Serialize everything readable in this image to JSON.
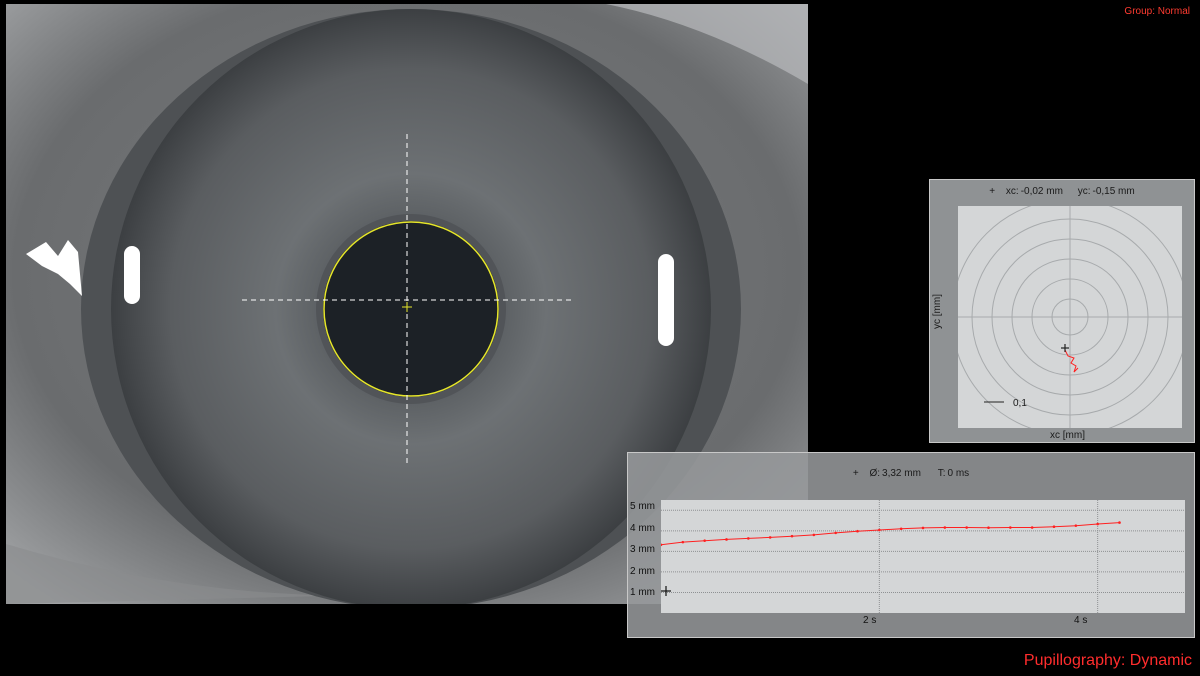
{
  "header": {
    "group_label": "Group: Normal"
  },
  "footer": {
    "mode_label": "Pupillography: Dynamic"
  },
  "center_panel": {
    "xc_label": "xc:",
    "xc_value": "-0,02 mm",
    "yc_label": "yc:",
    "yc_value": "-0,15 mm",
    "x_axis_label": "xc [mm]",
    "y_axis_label": "yc [mm]",
    "scale_value": "0,1",
    "marker_icon": "crosshair-marker-icon"
  },
  "trend_panel": {
    "diameter_label": "Ø:",
    "diameter_value": "3,32 mm",
    "time_label": "T:",
    "time_value": "0 ms",
    "y_ticks": [
      "5 mm",
      "4 mm",
      "3 mm",
      "2 mm",
      "1 mm"
    ],
    "x_ticks": [
      "2 s",
      "4 s"
    ]
  },
  "colors": {
    "trace": "#ff2020",
    "pupil_outline": "#e6e62a",
    "label_red": "#ff3b30"
  },
  "chart_data": {
    "type": "line",
    "x": [
      0,
      0.2,
      0.4,
      0.6,
      0.8,
      1.0,
      1.2,
      1.4,
      1.6,
      1.8,
      2.0,
      2.2,
      2.4,
      2.6,
      2.8,
      3.0,
      3.2,
      3.4,
      3.6,
      3.8,
      4.0,
      4.2
    ],
    "y": [
      3.32,
      3.45,
      3.52,
      3.58,
      3.63,
      3.68,
      3.74,
      3.8,
      3.9,
      3.98,
      4.04,
      4.1,
      4.14,
      4.16,
      4.16,
      4.15,
      4.16,
      4.16,
      4.2,
      4.25,
      4.33,
      4.4
    ],
    "xlim": [
      0,
      4.8
    ],
    "ylim": [
      0,
      5.5
    ],
    "xlabel": "",
    "ylabel": "",
    "grid": true
  }
}
